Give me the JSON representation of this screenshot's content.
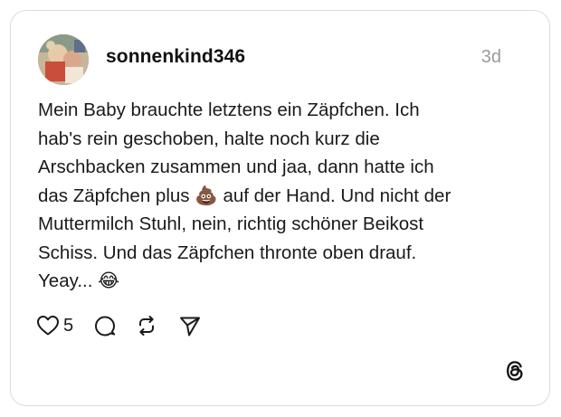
{
  "post": {
    "username": "sonnenkind346",
    "time": "3d",
    "lines": [
      "Mein Baby brauchte letztens ein Zäpfchen. Ich",
      "hab's rein geschoben, halte noch kurz die",
      "Arschbacken zusammen und jaa, dann hatte ich",
      "das Zäpfchen plus 💩 auf der Hand. Und nicht der",
      "Muttermilch Stuhl, nein, richtig schöner Beikost",
      "Schiss. Und das Zäpfchen thronte oben drauf.",
      "Yeay... 😂"
    ],
    "likes": "5"
  },
  "icons": {
    "like": "heart-icon",
    "comment": "comment-bubble-icon",
    "repost": "repost-icon",
    "share": "send-icon",
    "brand": "threads-logo-icon"
  },
  "colors": {
    "border": "#dcdcdc",
    "text": "#1a1a1a",
    "muted": "#9a9a9a"
  }
}
